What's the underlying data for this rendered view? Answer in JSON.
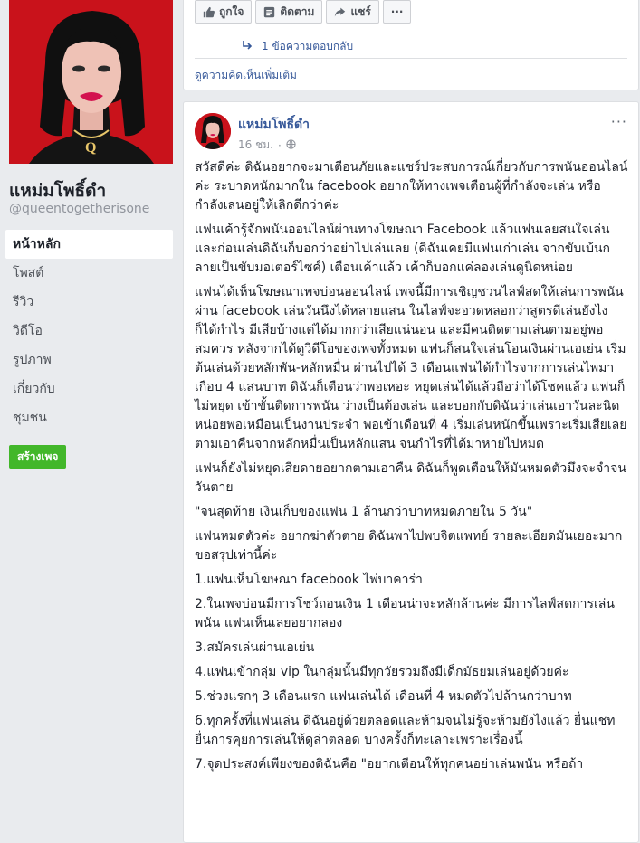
{
  "page": {
    "name": "แหม่มโพธิ์ดำ",
    "handle": "@queentogetherisone",
    "create_page_label": "สร้างเพจ"
  },
  "nav": [
    {
      "label": "หน้าหลัก",
      "active": true
    },
    {
      "label": "โพสต์"
    },
    {
      "label": "รีวิว"
    },
    {
      "label": "วิดีโอ"
    },
    {
      "label": "รูปภาพ"
    },
    {
      "label": "เกี่ยวกับ"
    },
    {
      "label": "ชุมชน"
    }
  ],
  "top_card": {
    "like_label": "ถูกใจ",
    "follow_label": "ติดตาม",
    "share_label": "แชร์",
    "more_label": "···",
    "replies_label": "1 ข้อความตอบกลับ",
    "more_comments_label": "ดูความคิดเห็นเพิ่มเติม"
  },
  "post": {
    "author": "แหม่มโพธิ์ดำ",
    "time": "16 ชม.",
    "menu": "···",
    "paragraphs": [
      "สวัสดีค่ะ ดิฉันอยากจะมาเตือนภัยและแชร์ประสบการณ์เกี่ยวกับการพนันออนไลน์ค่ะ ระบาดหนักมากใน facebook อยากให้ทางเพจเตือนผู้ที่กำลังจะเล่น หรือกำลังเล่นอยู่ให้เลิกดีกว่าค่ะ",
      "แฟนเค้ารู้จักพนันออนไลน์ผ่านทางโฆษณา Facebook แล้วแฟนเลยสนใจเล่น และก่อนเล่นดิฉันก็บอกว่าอย่าไปเล่นเลย (ดิฉันเคยมีแฟนเก่าเล่น จากขับเบ้นกลายเป็นขับมอเตอร์ไซค์) เตือนเค้าแล้ว เค้าก็บอกแค่ลองเล่นดูนิดหน่อย",
      "แฟนได้เห็นโฆษณาเพจบ่อนออนไลน์ เพจนี้มีการเชิญชวนไลฟ์สดให้เล่นการพนันผ่าน facebook เล่นวันนึงได้หลายแสน ในไลฟ์จะอวดหลอกว่าสูตรดีเล่นยังไงก็ได้กำไร มีเสียบ้างแต่ได้มากกว่าเสียแน่นอน และมีคนติดตามเล่นตามอยู่พอสมควร หลังจากได้ดูวีดีโอของเพจทั้งหมด แฟนก็สนใจเล่นโอนเงินผ่านเอเย่น เริ่มต้นเล่นด้วยหลักพัน-หลักหมื่น ผ่านไปได้ 3 เดือนแฟนได้กำไรจากการเล่นไพ่มาเกือบ 4 แสนบาท ดิฉันก็เตือนว่าพอเหอะ หยุดเล่นได้แล้วถือว่าได้โชคแล้ว แฟนก็ไม่หยุด เข้าขั้นติดการพนัน ว่างเป็นต้องเล่น และบอกกับดิฉันว่าเล่นเอาวันละนิดหน่อยพอเหมือนเป็นงานประจำ พอเข้าเดือนที่ 4 เริ่มเล่นหนักขึ้นเพราะเริ่มเสียเลยตามเอาคืนจากหลักหมื่นเป็นหลักแสน จนกำไรที่ได้มาหายไปหมด",
      "แฟนก็ยังไม่หยุดเสียดายอยากตามเอาคืน ดิฉันก็พูดเตือนให้มันหมดตัวมึงจะจำจนวันตาย",
      "\"จนสุดท้าย เงินเก็บของแฟน 1 ล้านกว่าบาทหมดภายใน 5 วัน\"",
      "แฟนหมดตัวค่ะ อยากฆ่าตัวตาย ดิฉันพาไปพบจิตแพทย์ รายละเอียดมันเยอะมากขอสรุปเท่านี้ค่ะ",
      "1.แฟนเห็นโฆษณา facebook ไพ่บาคาร่า",
      "2.ในเพจบ่อนมีการโชว์ถอนเงิน 1 เดือนน่าจะหลักล้านค่ะ มีการไลฟ์สดการเล่นพนัน แฟนเห็นเลยอยากลอง",
      "3.สมัครเล่นผ่านเอเย่น",
      "4.แฟนเข้ากลุ่ม vip ในกลุ่มนั้นมีทุกวัยรวมถึงมีเด็กมัธยมเล่นอยู่ด้วยค่ะ",
      "5.ช่วงแรกๆ 3 เดือนแรก แฟนเล่นได้ เดือนที่ 4 หมดตัวไปล้านกว่าบาท",
      "6.ทุกครั้งที่แฟนเล่น ดิฉันอยู่ด้วยตลอดและห้ามจนไม่รู้จะห้ามยังไงแล้ว ยื่นแชทยื่นการคุยการเล่นให้ดูล่าตลอด บางครั้งก็ทะเลาะเพราะเรื่องนี้",
      "7.จุดประสงค์เพียงของดิฉันคือ \"อยากเตือนให้ทุกคนอย่าเล่นพนัน หรือถ้า"
    ]
  },
  "colors": {
    "link": "#365899",
    "create_button": "#42b72a",
    "avatar_bg": "#c9121b"
  }
}
